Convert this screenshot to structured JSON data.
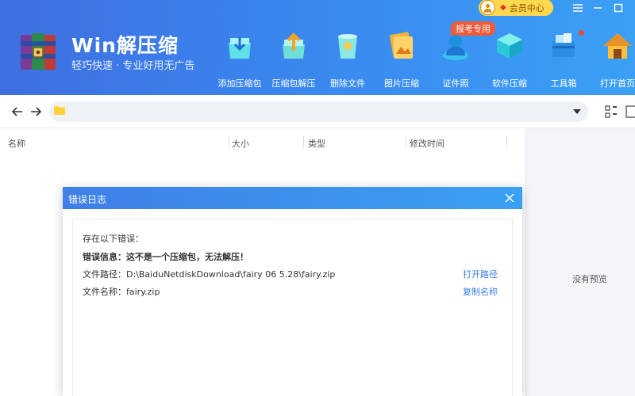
{
  "app": {
    "title": "Win解压缩",
    "subtitle": "轻巧快速 · 专业好用无广告",
    "member_label": "会员中心",
    "badge_label": "报考专用"
  },
  "toolbar": {
    "items": [
      {
        "label": "添加压缩包",
        "icon": "add-archive-icon"
      },
      {
        "label": "压缩包解压",
        "icon": "extract-archive-icon"
      },
      {
        "label": "删除文件",
        "icon": "trash-icon"
      },
      {
        "label": "图片压缩",
        "icon": "image-compress-icon"
      },
      {
        "label": "证件照",
        "icon": "id-photo-icon"
      },
      {
        "label": "软件压缩",
        "icon": "software-compress-icon"
      },
      {
        "label": "工具箱",
        "icon": "toolbox-icon"
      },
      {
        "label": "打开首页",
        "icon": "home-icon"
      }
    ]
  },
  "filelist": {
    "columns": [
      "名称",
      "大小",
      "类型",
      "修改时间"
    ]
  },
  "preview": {
    "empty_text": "没有预览"
  },
  "dialog": {
    "title": "错误日志",
    "intro": "存在以下错误：",
    "error_info": "错误信息：这不是一个压缩包，无法解压！",
    "file_path": "文件路径：D:\\BaiduNetdiskDownload\\fairy 06 5.28\\fairy.zip",
    "file_name": "文件名称：fairy.zip",
    "open_path_label": "打开路径",
    "copy_name_label": "复制名称"
  },
  "colors": {
    "header_start": "#3f6fe0",
    "header_end": "#3aa0f4",
    "link": "#3a7ee6",
    "badge": "#f05a3a",
    "member_pill": "#ffd84d"
  }
}
